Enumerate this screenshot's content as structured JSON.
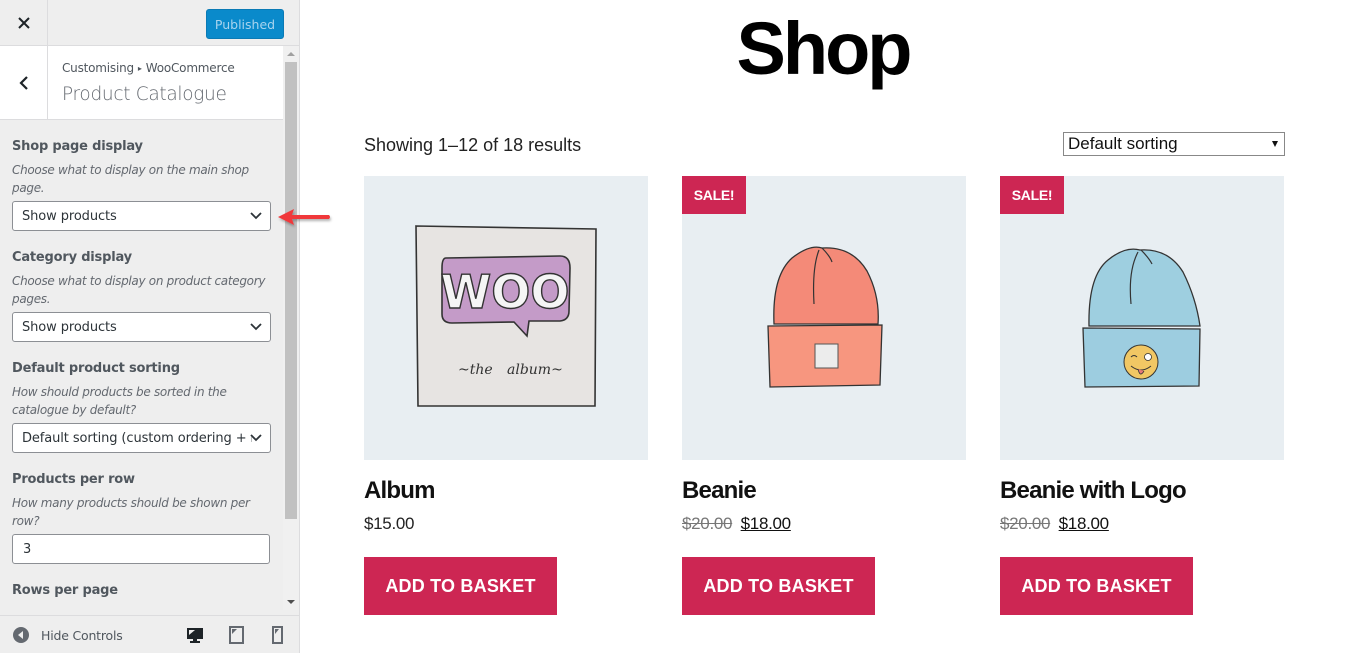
{
  "sidebar": {
    "close_label": "Close",
    "publish_button": "Published",
    "breadcrumb": {
      "root": "Customising",
      "separator": "▸",
      "parent": "WooCommerce"
    },
    "section_title": "Product Catalogue",
    "controls": [
      {
        "label": "Shop page display",
        "description": "Choose what to display on the main shop page.",
        "type": "select",
        "value": "Show products"
      },
      {
        "label": "Category display",
        "description": "Choose what to display on product category pages.",
        "type": "select",
        "value": "Show products"
      },
      {
        "label": "Default product sorting",
        "description": "How should products be sorted in the catalogue by default?",
        "type": "select",
        "value": "Default sorting (custom ordering + name)"
      },
      {
        "label": "Products per row",
        "description": "How many products should be shown per row?",
        "type": "number",
        "value": "3"
      },
      {
        "label": "Rows per page"
      }
    ],
    "footer": {
      "hide_controls": "Hide Controls",
      "devices": [
        "desktop",
        "tablet",
        "mobile"
      ],
      "active_device": "desktop"
    }
  },
  "annotation": {
    "arrow_color": "#f0393b",
    "points_to": "Shop page display"
  },
  "shop": {
    "title": "Shop",
    "result_count": "Showing 1–12 of 18 results",
    "ordering": {
      "selected": "Default sorting"
    },
    "products": [
      {
        "name": "Album",
        "price": "$15.00",
        "regular_price": null,
        "sale": false,
        "button": "ADD TO BASKET",
        "image": "woo-album-illustration"
      },
      {
        "name": "Beanie",
        "price": "$18.00",
        "regular_price": "$20.00",
        "sale": true,
        "sale_label": "SALE!",
        "button": "ADD TO BASKET",
        "image": "orange-beanie-illustration"
      },
      {
        "name": "Beanie with Logo",
        "price": "$18.00",
        "regular_price": "$20.00",
        "sale": true,
        "sale_label": "SALE!",
        "button": "ADD TO BASKET",
        "image": "blue-beanie-emoji-illustration"
      }
    ]
  },
  "colors": {
    "accent": "#cd2653",
    "publish_blue": "#0a8acb",
    "product_bg": "#e8eef2",
    "sidebar_bg": "#eeeeee"
  }
}
